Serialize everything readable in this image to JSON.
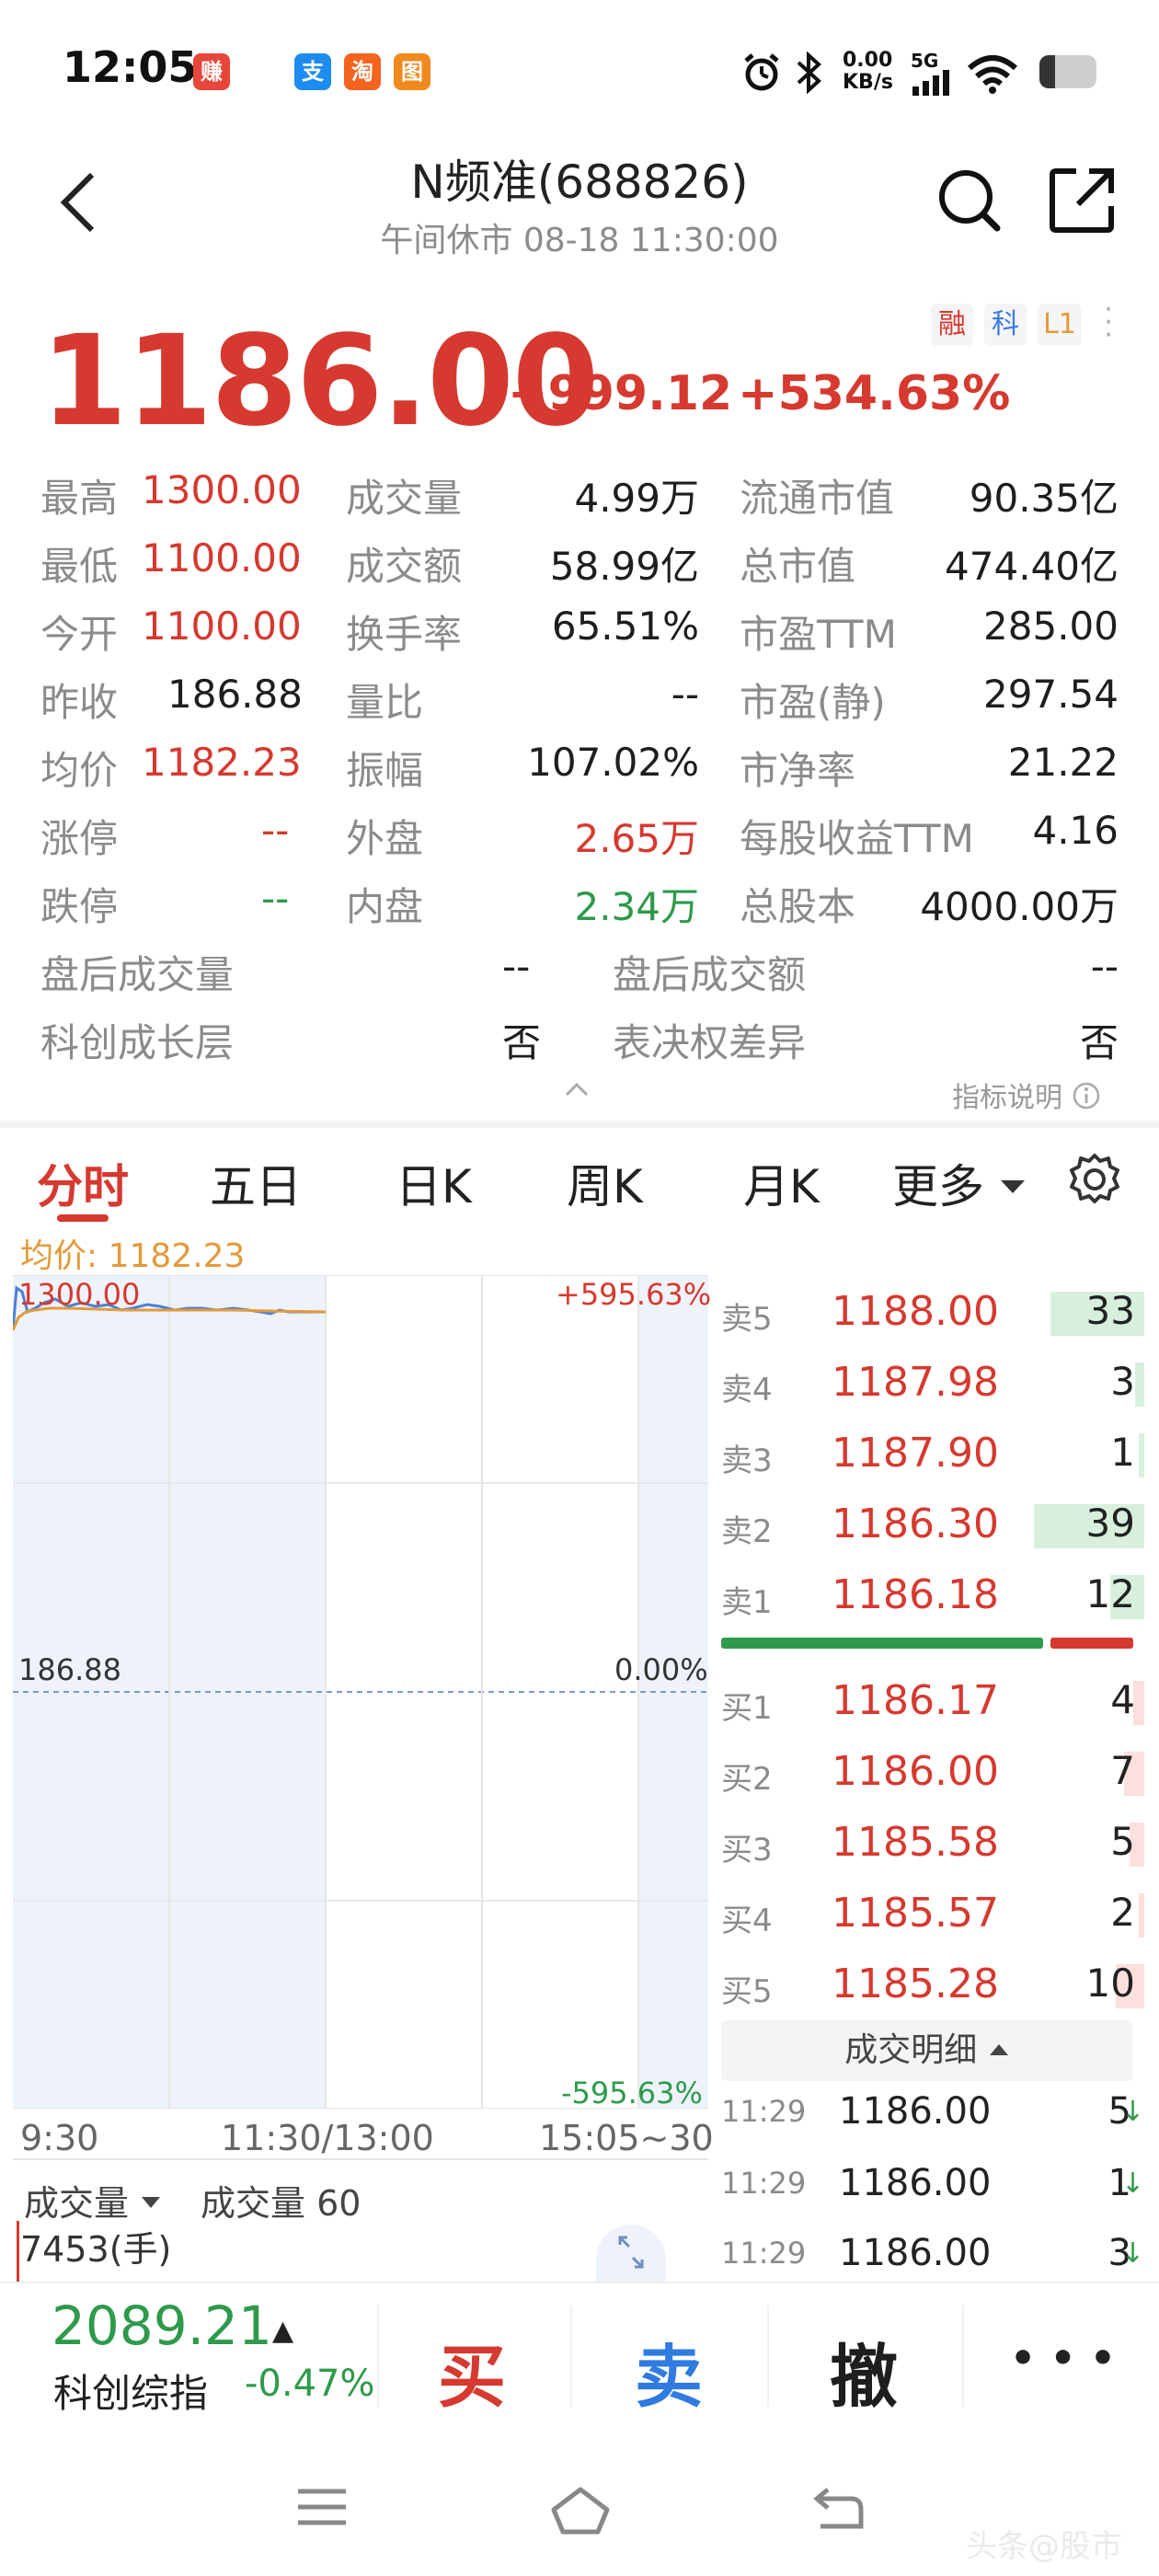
{
  "status_bar": {
    "time": "12:05",
    "app_icons": [
      {
        "name": "zhuan-app-icon",
        "text": "赚",
        "color": "#e8463a"
      },
      {
        "name": "alipay-app-icon",
        "text": "支",
        "color": "#1d8cf0"
      },
      {
        "name": "taobao-app-icon",
        "text": "淘",
        "color": "#f5641e"
      },
      {
        "name": "amap-app-icon",
        "text": "图",
        "color": "#f08a1e"
      }
    ],
    "net_speed": "0.00",
    "net_unit": "KB/s",
    "signal": "5G"
  },
  "header": {
    "title": "N频准(688826)",
    "subtitle": "午间休市  08-18  11:30:00"
  },
  "badges": [
    "融",
    "科",
    "L1"
  ],
  "quote": {
    "price": "1186.00",
    "change": "+999.12",
    "change_pct": "+534.63%"
  },
  "stats": {
    "col1": [
      {
        "label": "最高",
        "value": "1300.00",
        "color": "red"
      },
      {
        "label": "最低",
        "value": "1100.00",
        "color": "red"
      },
      {
        "label": "今开",
        "value": "1100.00",
        "color": "red"
      },
      {
        "label": "昨收",
        "value": "186.88",
        "color": "dark"
      },
      {
        "label": "均价",
        "value": "1182.23",
        "color": "red"
      },
      {
        "label": "涨停",
        "value": "--",
        "color": "red"
      },
      {
        "label": "跌停",
        "value": "--",
        "color": "green"
      }
    ],
    "col2": [
      {
        "label": "成交量",
        "value": "4.99万",
        "color": "dark"
      },
      {
        "label": "成交额",
        "value": "58.99亿",
        "color": "dark"
      },
      {
        "label": "换手率",
        "value": "65.51%",
        "color": "dark"
      },
      {
        "label": "量比",
        "value": "--",
        "color": "dark"
      },
      {
        "label": "振幅",
        "value": "107.02%",
        "color": "dark"
      },
      {
        "label": "外盘",
        "value": "2.65万",
        "color": "red"
      },
      {
        "label": "内盘",
        "value": "2.34万",
        "color": "green"
      }
    ],
    "col3": [
      {
        "label": "流通市值",
        "value": "90.35亿"
      },
      {
        "label": "总市值",
        "value": "474.40亿"
      },
      {
        "label": "市盈TTM",
        "value": "285.00"
      },
      {
        "label": "市盈(静)",
        "value": "297.54"
      },
      {
        "label": "市净率",
        "value": "21.22"
      },
      {
        "label": "每股收益TTM",
        "value": "4.16"
      },
      {
        "label": "总股本",
        "value": "4000.00万"
      }
    ],
    "extra": [
      {
        "label": "盘后成交量",
        "value": "--"
      },
      {
        "label": "盘后成交额",
        "value": "--"
      },
      {
        "label": "科创成长层",
        "value": "否"
      },
      {
        "label": "表决权差异",
        "value": "否"
      }
    ],
    "help_text": "指标说明"
  },
  "tabs": [
    "分时",
    "五日",
    "日K",
    "周K",
    "月K",
    "更多"
  ],
  "active_tab": "分时",
  "chart": {
    "avg_label": "均价: 1182.23",
    "top_price": "1300.00",
    "top_pct": "+595.63%",
    "mid_price": "186.88",
    "mid_pct": "0.00%",
    "bottom_pct": "-595.63%",
    "time_labels": [
      "9:30",
      "11:30/13:00",
      "15:05~30"
    ],
    "price_line_color": "#4a7fd6",
    "avg_line_color": "#e39a3a"
  },
  "order_book": {
    "asks": [
      {
        "label": "卖5",
        "price": "1188.00",
        "vol": "33",
        "bar": 0.85
      },
      {
        "label": "卖4",
        "price": "1187.98",
        "vol": "3",
        "bar": 0.08
      },
      {
        "label": "卖3",
        "price": "1187.90",
        "vol": "1",
        "bar": 0.03
      },
      {
        "label": "卖2",
        "price": "1186.30",
        "vol": "39",
        "bar": 1.0
      },
      {
        "label": "卖1",
        "price": "1186.18",
        "vol": "12",
        "bar": 0.31
      }
    ],
    "buy_ratio": 0.79,
    "bids": [
      {
        "label": "买1",
        "price": "1186.17",
        "vol": "4",
        "bar": 0.1
      },
      {
        "label": "买2",
        "price": "1186.00",
        "vol": "7",
        "bar": 0.18
      },
      {
        "label": "买3",
        "price": "1185.58",
        "vol": "5",
        "bar": 0.13
      },
      {
        "label": "买4",
        "price": "1185.57",
        "vol": "2",
        "bar": 0.05
      },
      {
        "label": "买5",
        "price": "1185.28",
        "vol": "10",
        "bar": 0.26
      }
    ]
  },
  "deals": {
    "header": "成交明细",
    "rows": [
      {
        "time": "11:29",
        "price": "1186.00",
        "vol": "5"
      },
      {
        "time": "11:29",
        "price": "1186.00",
        "vol": "1"
      },
      {
        "time": "11:29",
        "price": "1186.00",
        "vol": "3"
      }
    ]
  },
  "volume": {
    "selector": "成交量",
    "label": "成交量 60",
    "value": "7453(手)"
  },
  "bottom": {
    "index_value": "2089.21",
    "index_name": "科创综指",
    "index_change": "-0.47%",
    "buy": "买",
    "sell": "卖",
    "cancel": "撤",
    "more": "• • •"
  },
  "watermark": "头条@股市"
}
